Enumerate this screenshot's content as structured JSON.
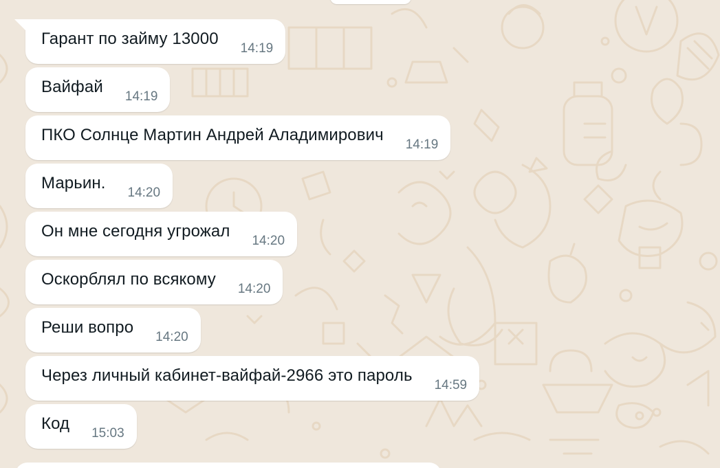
{
  "colors": {
    "background": "#efe7dc",
    "bubble": "#ffffff",
    "text": "#111b21",
    "time": "#667781",
    "doodle": "#e6d6c2"
  },
  "messages": [
    {
      "text": "Гарант по займу 13000",
      "time": "14:19"
    },
    {
      "text": "Вайфай",
      "time": "14:19"
    },
    {
      "text": "ПКО Солнце Мартин Андрей Аладимирович",
      "time": "14:19"
    },
    {
      "text": "Марьин.",
      "time": "14:20"
    },
    {
      "text": "Он мне сегодня угрожал",
      "time": "14:20"
    },
    {
      "text": "Оскорблял по всякому",
      "time": "14:20"
    },
    {
      "text": "Реши вопро",
      "time": "14:20"
    },
    {
      "text": "Через личный кабинет-вайфай-2966 это пароль",
      "time": "14:59"
    },
    {
      "text": "Код",
      "time": "15:03"
    }
  ]
}
